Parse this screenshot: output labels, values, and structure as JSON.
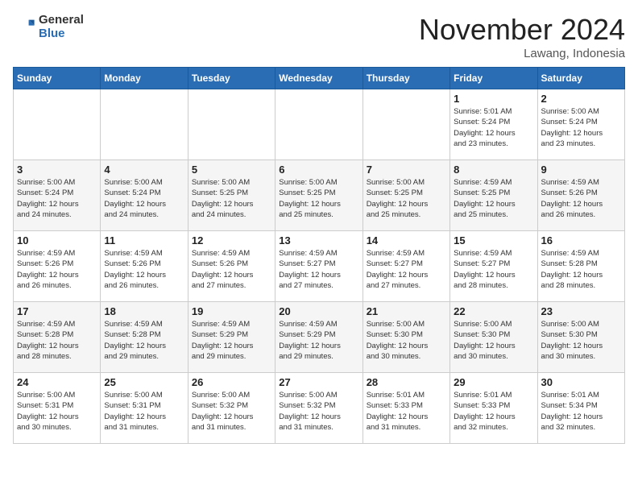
{
  "header": {
    "logo_general": "General",
    "logo_blue": "Blue",
    "month_title": "November 2024",
    "subtitle": "Lawang, Indonesia"
  },
  "days_of_week": [
    "Sunday",
    "Monday",
    "Tuesday",
    "Wednesday",
    "Thursday",
    "Friday",
    "Saturday"
  ],
  "weeks": [
    [
      {
        "day": "",
        "info": ""
      },
      {
        "day": "",
        "info": ""
      },
      {
        "day": "",
        "info": ""
      },
      {
        "day": "",
        "info": ""
      },
      {
        "day": "",
        "info": ""
      },
      {
        "day": "1",
        "info": "Sunrise: 5:01 AM\nSunset: 5:24 PM\nDaylight: 12 hours\nand 23 minutes."
      },
      {
        "day": "2",
        "info": "Sunrise: 5:00 AM\nSunset: 5:24 PM\nDaylight: 12 hours\nand 23 minutes."
      }
    ],
    [
      {
        "day": "3",
        "info": "Sunrise: 5:00 AM\nSunset: 5:24 PM\nDaylight: 12 hours\nand 24 minutes."
      },
      {
        "day": "4",
        "info": "Sunrise: 5:00 AM\nSunset: 5:24 PM\nDaylight: 12 hours\nand 24 minutes."
      },
      {
        "day": "5",
        "info": "Sunrise: 5:00 AM\nSunset: 5:25 PM\nDaylight: 12 hours\nand 24 minutes."
      },
      {
        "day": "6",
        "info": "Sunrise: 5:00 AM\nSunset: 5:25 PM\nDaylight: 12 hours\nand 25 minutes."
      },
      {
        "day": "7",
        "info": "Sunrise: 5:00 AM\nSunset: 5:25 PM\nDaylight: 12 hours\nand 25 minutes."
      },
      {
        "day": "8",
        "info": "Sunrise: 4:59 AM\nSunset: 5:25 PM\nDaylight: 12 hours\nand 25 minutes."
      },
      {
        "day": "9",
        "info": "Sunrise: 4:59 AM\nSunset: 5:26 PM\nDaylight: 12 hours\nand 26 minutes."
      }
    ],
    [
      {
        "day": "10",
        "info": "Sunrise: 4:59 AM\nSunset: 5:26 PM\nDaylight: 12 hours\nand 26 minutes."
      },
      {
        "day": "11",
        "info": "Sunrise: 4:59 AM\nSunset: 5:26 PM\nDaylight: 12 hours\nand 26 minutes."
      },
      {
        "day": "12",
        "info": "Sunrise: 4:59 AM\nSunset: 5:26 PM\nDaylight: 12 hours\nand 27 minutes."
      },
      {
        "day": "13",
        "info": "Sunrise: 4:59 AM\nSunset: 5:27 PM\nDaylight: 12 hours\nand 27 minutes."
      },
      {
        "day": "14",
        "info": "Sunrise: 4:59 AM\nSunset: 5:27 PM\nDaylight: 12 hours\nand 27 minutes."
      },
      {
        "day": "15",
        "info": "Sunrise: 4:59 AM\nSunset: 5:27 PM\nDaylight: 12 hours\nand 28 minutes."
      },
      {
        "day": "16",
        "info": "Sunrise: 4:59 AM\nSunset: 5:28 PM\nDaylight: 12 hours\nand 28 minutes."
      }
    ],
    [
      {
        "day": "17",
        "info": "Sunrise: 4:59 AM\nSunset: 5:28 PM\nDaylight: 12 hours\nand 28 minutes."
      },
      {
        "day": "18",
        "info": "Sunrise: 4:59 AM\nSunset: 5:28 PM\nDaylight: 12 hours\nand 29 minutes."
      },
      {
        "day": "19",
        "info": "Sunrise: 4:59 AM\nSunset: 5:29 PM\nDaylight: 12 hours\nand 29 minutes."
      },
      {
        "day": "20",
        "info": "Sunrise: 4:59 AM\nSunset: 5:29 PM\nDaylight: 12 hours\nand 29 minutes."
      },
      {
        "day": "21",
        "info": "Sunrise: 5:00 AM\nSunset: 5:30 PM\nDaylight: 12 hours\nand 30 minutes."
      },
      {
        "day": "22",
        "info": "Sunrise: 5:00 AM\nSunset: 5:30 PM\nDaylight: 12 hours\nand 30 minutes."
      },
      {
        "day": "23",
        "info": "Sunrise: 5:00 AM\nSunset: 5:30 PM\nDaylight: 12 hours\nand 30 minutes."
      }
    ],
    [
      {
        "day": "24",
        "info": "Sunrise: 5:00 AM\nSunset: 5:31 PM\nDaylight: 12 hours\nand 30 minutes."
      },
      {
        "day": "25",
        "info": "Sunrise: 5:00 AM\nSunset: 5:31 PM\nDaylight: 12 hours\nand 31 minutes."
      },
      {
        "day": "26",
        "info": "Sunrise: 5:00 AM\nSunset: 5:32 PM\nDaylight: 12 hours\nand 31 minutes."
      },
      {
        "day": "27",
        "info": "Sunrise: 5:00 AM\nSunset: 5:32 PM\nDaylight: 12 hours\nand 31 minutes."
      },
      {
        "day": "28",
        "info": "Sunrise: 5:01 AM\nSunset: 5:33 PM\nDaylight: 12 hours\nand 31 minutes."
      },
      {
        "day": "29",
        "info": "Sunrise: 5:01 AM\nSunset: 5:33 PM\nDaylight: 12 hours\nand 32 minutes."
      },
      {
        "day": "30",
        "info": "Sunrise: 5:01 AM\nSunset: 5:34 PM\nDaylight: 12 hours\nand 32 minutes."
      }
    ]
  ]
}
